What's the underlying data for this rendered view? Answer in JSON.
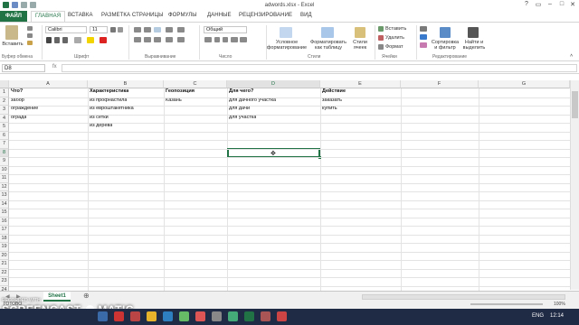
{
  "window": {
    "title": "adwords.xlsx - Excel",
    "controls": [
      "?",
      "▭",
      "–",
      "□",
      "✕"
    ]
  },
  "ribbon_tabs": [
    "ФАЙЛ",
    "ГЛАВНАЯ",
    "ВСТАВКА",
    "РАЗМЕТКА СТРАНИЦЫ",
    "ФОРМУЛЫ",
    "ДАННЫЕ",
    "РЕЦЕНЗИРОВАНИЕ",
    "ВИД"
  ],
  "ribbon": {
    "groups": [
      "Буфер обмена",
      "Шрифт",
      "Выравнивание",
      "Число",
      "Стили",
      "Ячейки",
      "Редактирование"
    ],
    "paste_label": "Вставить",
    "font_name": "Calibri",
    "font_size": "11",
    "number_format": "Общий",
    "cond_format": [
      "Условное",
      "форматирование"
    ],
    "format_table": [
      "Форматировать",
      "как таблицу"
    ],
    "cell_styles": [
      "Стили",
      "ячеек"
    ],
    "insert": "Вставить",
    "delete": "Удалить",
    "format": "Формат",
    "sort": [
      "Сортировка",
      "и фильтр"
    ],
    "find": [
      "Найти и",
      "выделить"
    ]
  },
  "formula_bar": {
    "name_box": "D8",
    "fx": "fx",
    "value": ""
  },
  "columns": [
    "A",
    "B",
    "C",
    "D",
    "E",
    "F",
    "G"
  ],
  "rows": [
    "1",
    "2",
    "3",
    "4",
    "5",
    "6",
    "7",
    "8",
    "9",
    "10",
    "11",
    "12",
    "13",
    "14",
    "15",
    "16",
    "17",
    "18",
    "19",
    "20",
    "21",
    "22",
    "23",
    "24"
  ],
  "cells": {
    "A1": "Что?",
    "B1": "Характеристика",
    "C1": "Геопозиция",
    "D1": "Для чего?",
    "E1": "Действие",
    "A2": "забор",
    "B2": "из профнастила",
    "C2": "Казань",
    "D2": "для дачного участка",
    "E2": "заказать",
    "A3": "ограждение",
    "B3": "из евроштакетника",
    "D3": "для дачи",
    "E3": "купить",
    "A4": "ограда",
    "B4": "из сетки",
    "D4": "для участка",
    "B5": "из дерева"
  },
  "sheet_tab": "Sheet1",
  "status": {
    "left": "ГОТОВО",
    "zoom": "100%"
  },
  "watermark": {
    "line1": "RECORDED WITH",
    "line2": "SCREENCAST",
    "line3": "MATIC"
  },
  "taskbar": {
    "lang": "ENG",
    "time": "12:14"
  }
}
